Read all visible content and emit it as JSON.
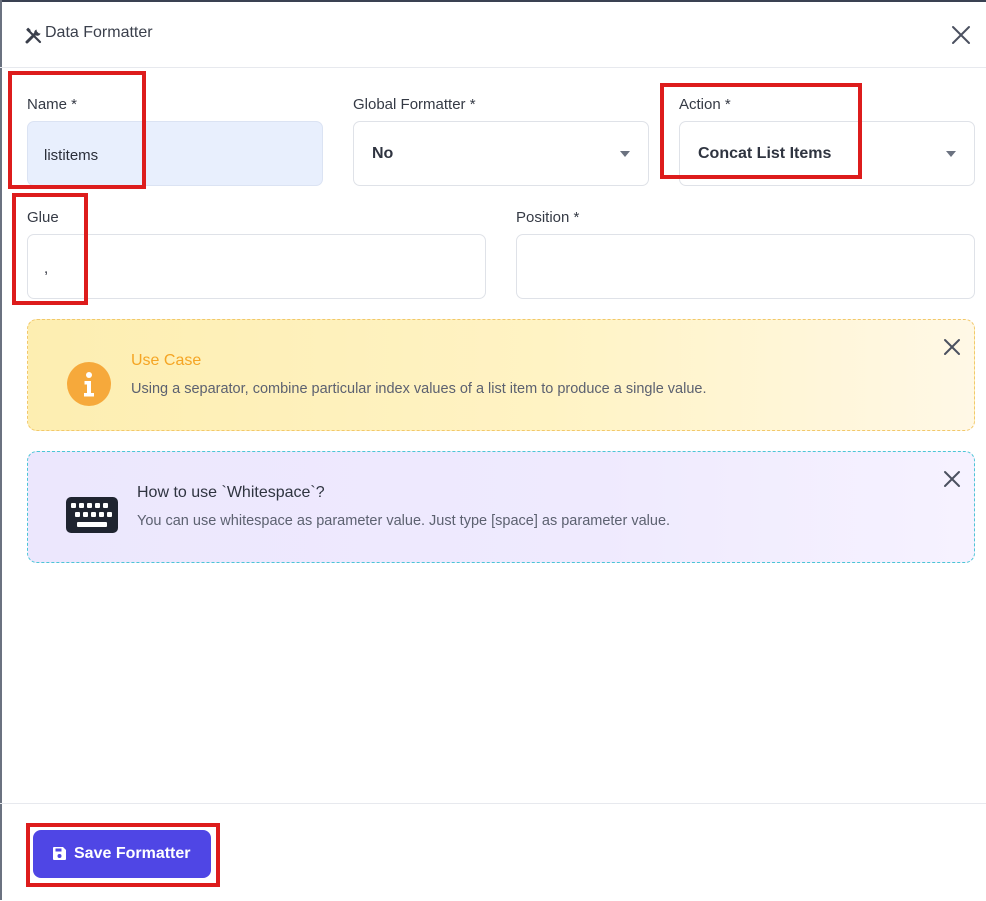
{
  "header": {
    "title": "Data Formatter",
    "icon": "tools-icon",
    "close_icon": "close-icon"
  },
  "form": {
    "name": {
      "label": "Name *",
      "value": "listitems"
    },
    "global_formatter": {
      "label": "Global Formatter *",
      "value": "No"
    },
    "action": {
      "label": "Action *",
      "value": "Concat List Items"
    },
    "glue": {
      "label": "Glue",
      "value": ","
    },
    "position": {
      "label": "Position *",
      "value": ""
    }
  },
  "alerts": {
    "use_case": {
      "title": "Use Case",
      "body": "Using a separator, combine particular index values of a list item to produce a single value.",
      "icon": "info-icon",
      "title_color": "#f5a524",
      "icon_color": "#f6a93b"
    },
    "whitespace": {
      "title": "How to use `Whitespace`?",
      "body": "You can use whitespace as parameter value. Just type [space] as parameter value.",
      "icon": "keyboard-icon"
    }
  },
  "footer": {
    "save_label": "Save Formatter",
    "save_icon": "save-icon",
    "accent": "#4f46e5"
  },
  "highlight_color": "#dd1c1c"
}
